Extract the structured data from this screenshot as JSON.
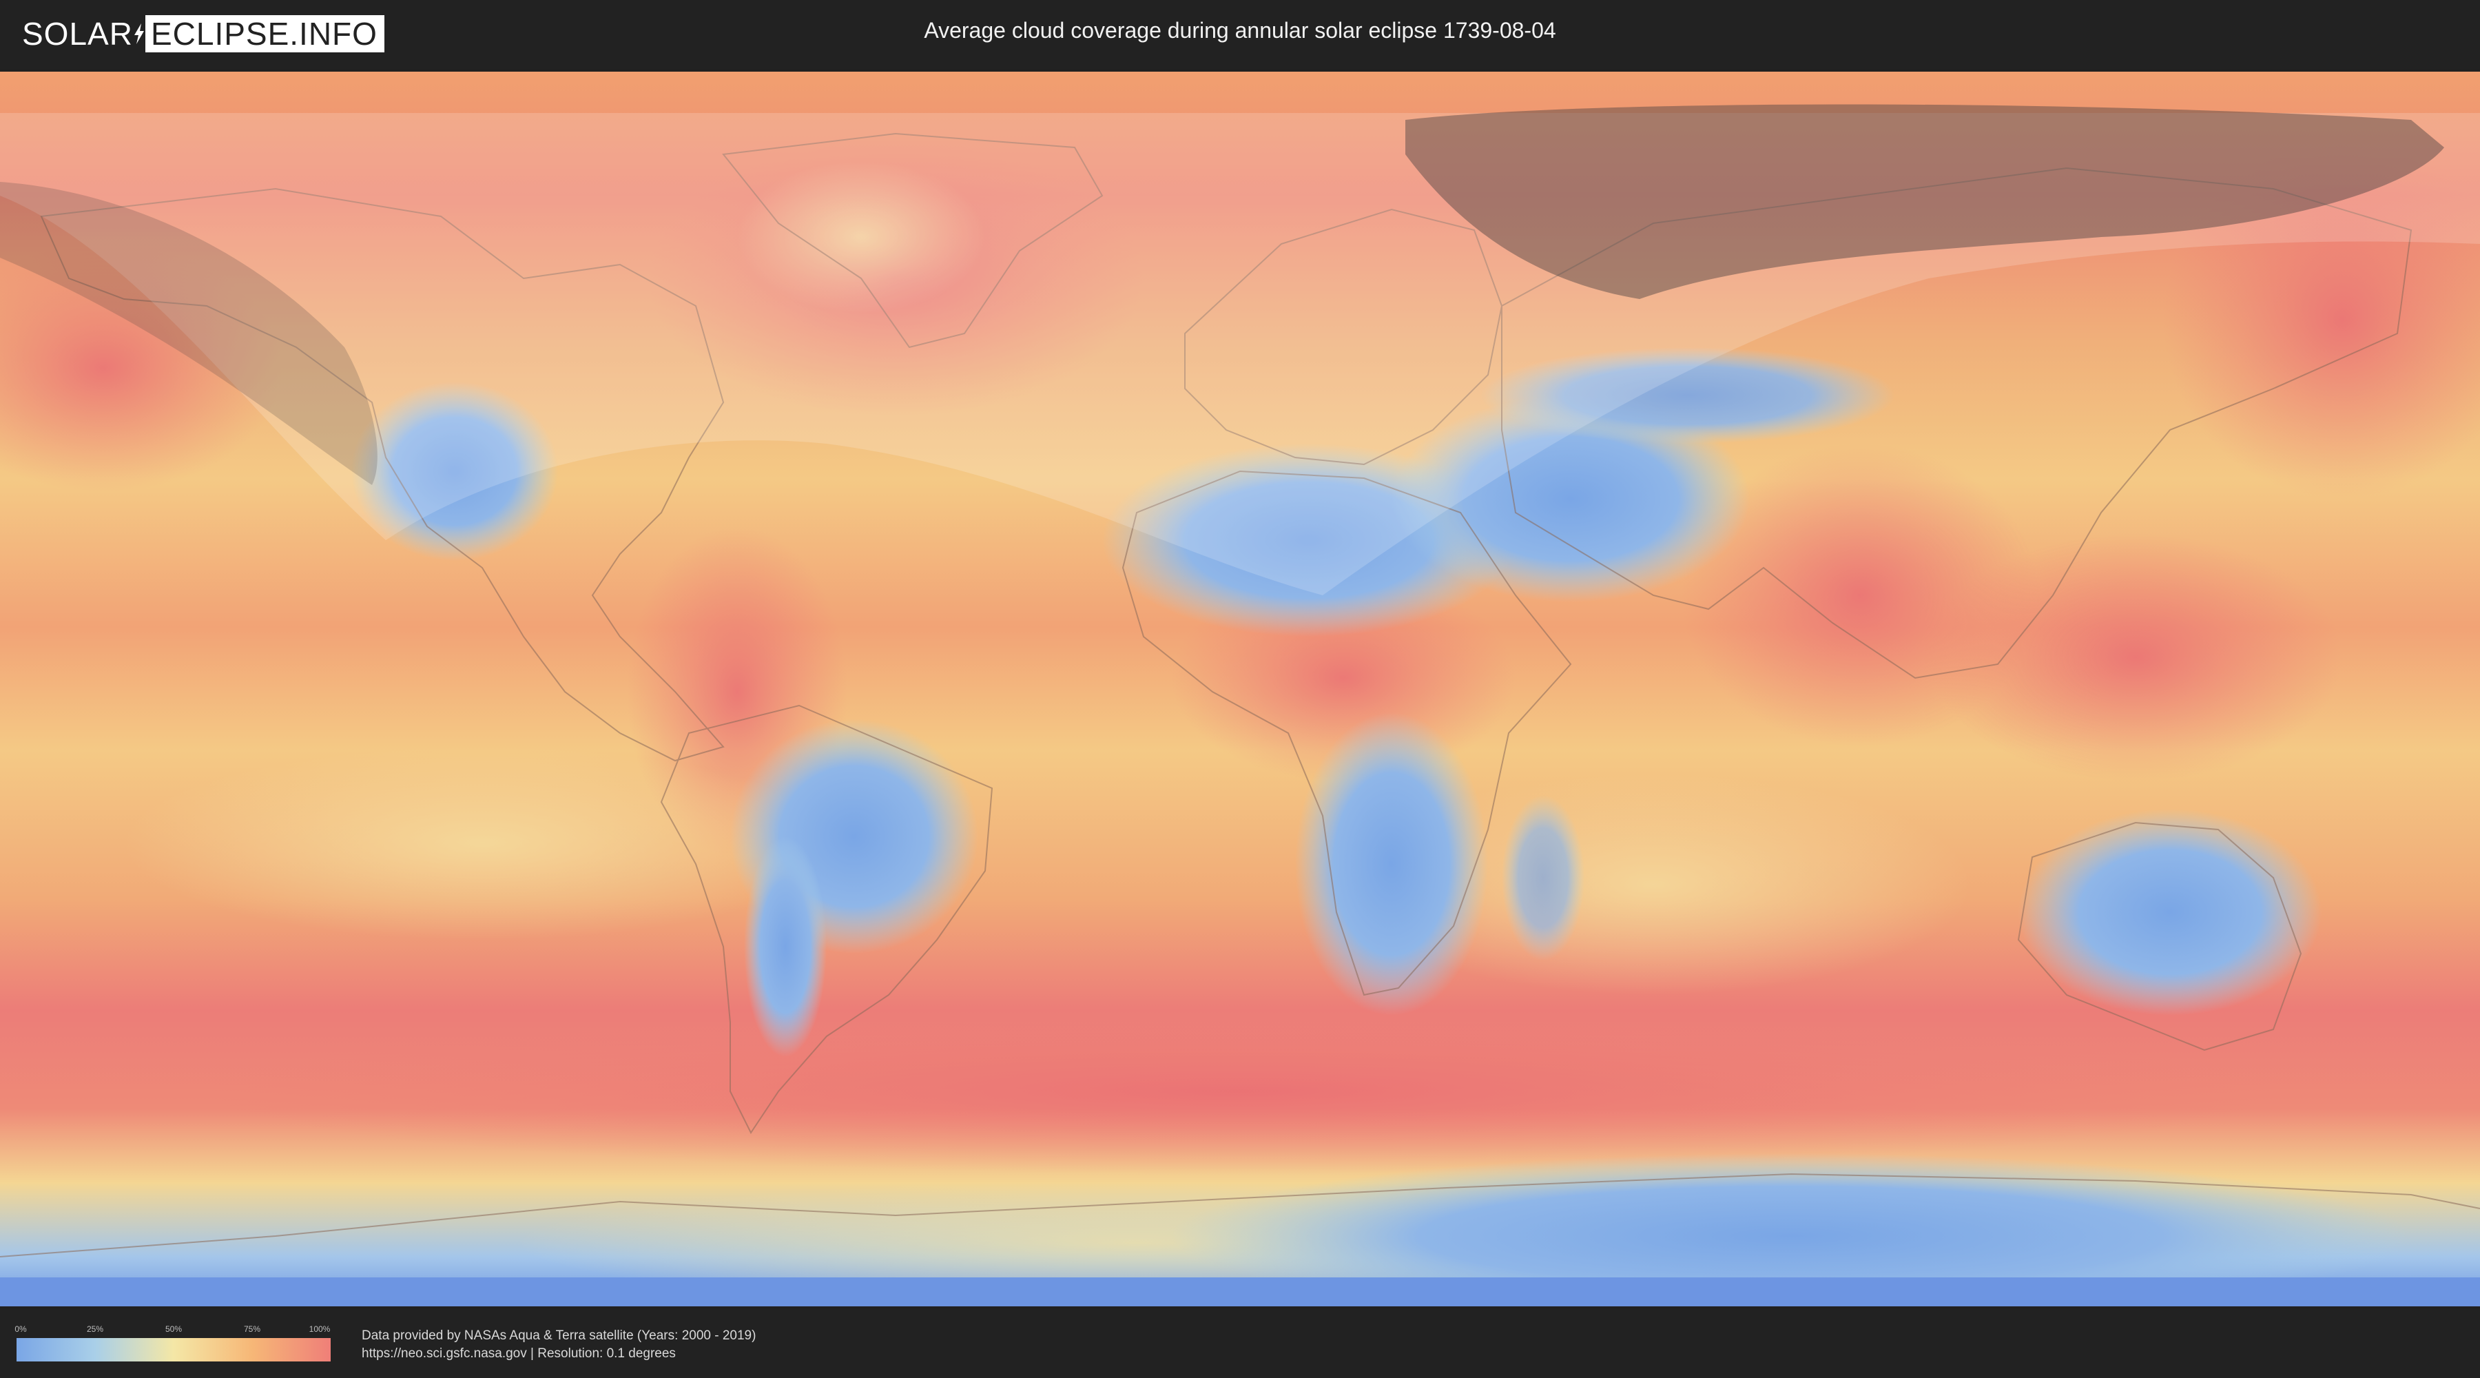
{
  "header": {
    "logo_left": "SOLAR",
    "logo_right": "ECLIPSE.INFO",
    "title": "Average cloud coverage during annular solar eclipse 1739-08-04"
  },
  "legend": {
    "ticks": [
      "0%",
      "25%",
      "50%",
      "75%",
      "100%"
    ],
    "colors": {
      "low": "#7aa6e6",
      "mid_low": "#a9cfe8",
      "mid": "#f4e7a6",
      "mid_high": "#f6b777",
      "high": "#ef7f78"
    }
  },
  "credits": {
    "line1": "Data provided by NASAs Aqua & Terra satellite (Years: 2000 - 2019)",
    "line2": "https://neo.sci.gsfc.nasa.gov | Resolution: 0.1 degrees"
  },
  "map": {
    "colors": {
      "cloudy": "#ef7f78",
      "partly": "#f6b777",
      "light": "#f4e7a6",
      "clear": "#7aa6e6",
      "ocean_base": "#f3a36f",
      "shadow": "#4a4040",
      "night": "#ffffff"
    }
  }
}
